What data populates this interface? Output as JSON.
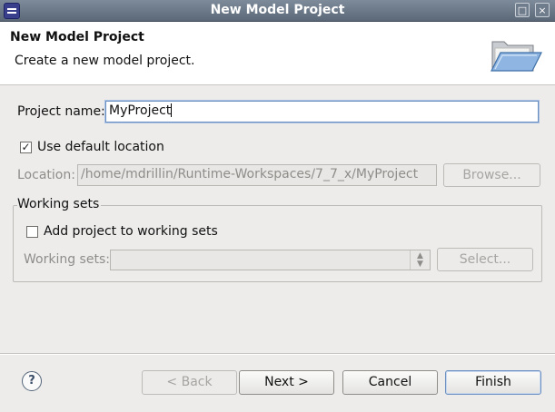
{
  "window": {
    "title": "New Model Project",
    "minimize_icon": "maximize-icon",
    "close_icon": "close-icon"
  },
  "header": {
    "title": "New Model Project",
    "description": "Create a new model project.",
    "banner_icon": "open-folder-icon"
  },
  "form": {
    "project_name_label": "Project name:",
    "project_name_value": "MyProject",
    "use_default_location_label": "Use default location",
    "use_default_location_checked": true,
    "location_label": "Location:",
    "location_value": "/home/mdrillin/Runtime-Workspaces/7_7_x/MyProject",
    "browse_label": "Browse..."
  },
  "working_sets": {
    "group_title": "Working sets",
    "add_to_working_sets_label": "Add project to working sets",
    "add_to_working_sets_checked": false,
    "working_sets_label": "Working sets:",
    "working_sets_value": "",
    "select_label": "Select..."
  },
  "footer": {
    "help_icon": "help-icon",
    "back_label": "< Back",
    "next_label": "Next >",
    "cancel_label": "Cancel",
    "finish_label": "Finish"
  },
  "colors": {
    "titlebar": "#6b7888",
    "dialog_bg": "#edeceb",
    "header_bg": "#ffffff",
    "focus_border": "#6a8fc0"
  }
}
